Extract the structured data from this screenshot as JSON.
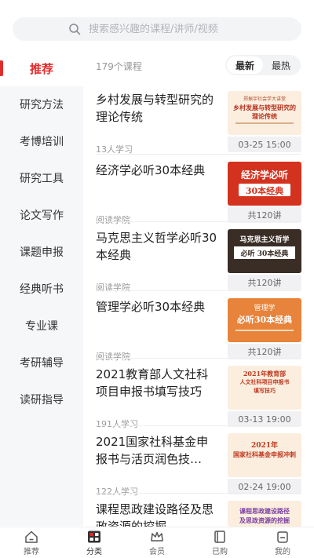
{
  "search": {
    "placeholder": "搜索感兴趣的课程/讲师/视频"
  },
  "sidebar": {
    "items": [
      {
        "label": "推荐"
      },
      {
        "label": "研究方法"
      },
      {
        "label": "考博培训"
      },
      {
        "label": "研究工具"
      },
      {
        "label": "论文写作"
      },
      {
        "label": "课题申报"
      },
      {
        "label": "经典听书"
      },
      {
        "label": "专业课"
      },
      {
        "label": "考研辅导"
      },
      {
        "label": "读研指导"
      }
    ]
  },
  "main": {
    "count": "179个课程",
    "sort": {
      "newest": "最新",
      "hottest": "最热"
    },
    "courses": [
      {
        "title": "乡村发展与转型研究的理论传统",
        "sub": "13人学习",
        "meta": "03-25 15:00",
        "thumb": {
          "line1": "郑振宇社会学大讲堂",
          "line2": "乡村发展与转型研究的",
          "line3": "理论传统"
        }
      },
      {
        "title": "经济学必听30本经典",
        "sub": "阅读学院",
        "meta": "共120讲",
        "thumb": {
          "line1": "经济学必听",
          "line2": "30本经典"
        }
      },
      {
        "title": "马克思主义哲学必听30本经典",
        "sub": "阅读学院",
        "meta": "共120讲",
        "thumb": {
          "line1": "马克思主义哲学",
          "line2": "必听 30本经典"
        }
      },
      {
        "title": "管理学必听30本经典",
        "sub": "阅读学院",
        "meta": "共120讲",
        "thumb": {
          "line1": "管理学",
          "line2": "必听30本经典"
        }
      },
      {
        "title": "2021教育部人文社科项目申报书填写技巧",
        "sub": "191人学习",
        "meta": "03-13 19:00",
        "thumb": {
          "line1": "2021年教育部",
          "line2": "人文社科项目申报书",
          "line3": "填写技巧"
        }
      },
      {
        "title": "2021国家社科基金申报书与活页润色技…",
        "sub": "122人学习",
        "meta": "02-24 19:00",
        "thumb": {
          "line1": "2021年",
          "line2": "国家社科基金申报冲刺"
        }
      },
      {
        "title": "课程思政建设路径及思政资源的挖掘",
        "sub": "",
        "meta": "",
        "thumb": {
          "line1": "课程思政建设路径",
          "line2": "及思政资源的挖掘"
        }
      }
    ]
  },
  "tabbar": {
    "items": [
      {
        "label": "推荐"
      },
      {
        "label": "分类"
      },
      {
        "label": "会员"
      },
      {
        "label": "已购"
      },
      {
        "label": "我的"
      }
    ]
  },
  "colors": {
    "accent": "#e22c2c",
    "sidebar_bg": "#f6f7f9",
    "muted": "#9a9a9a"
  }
}
